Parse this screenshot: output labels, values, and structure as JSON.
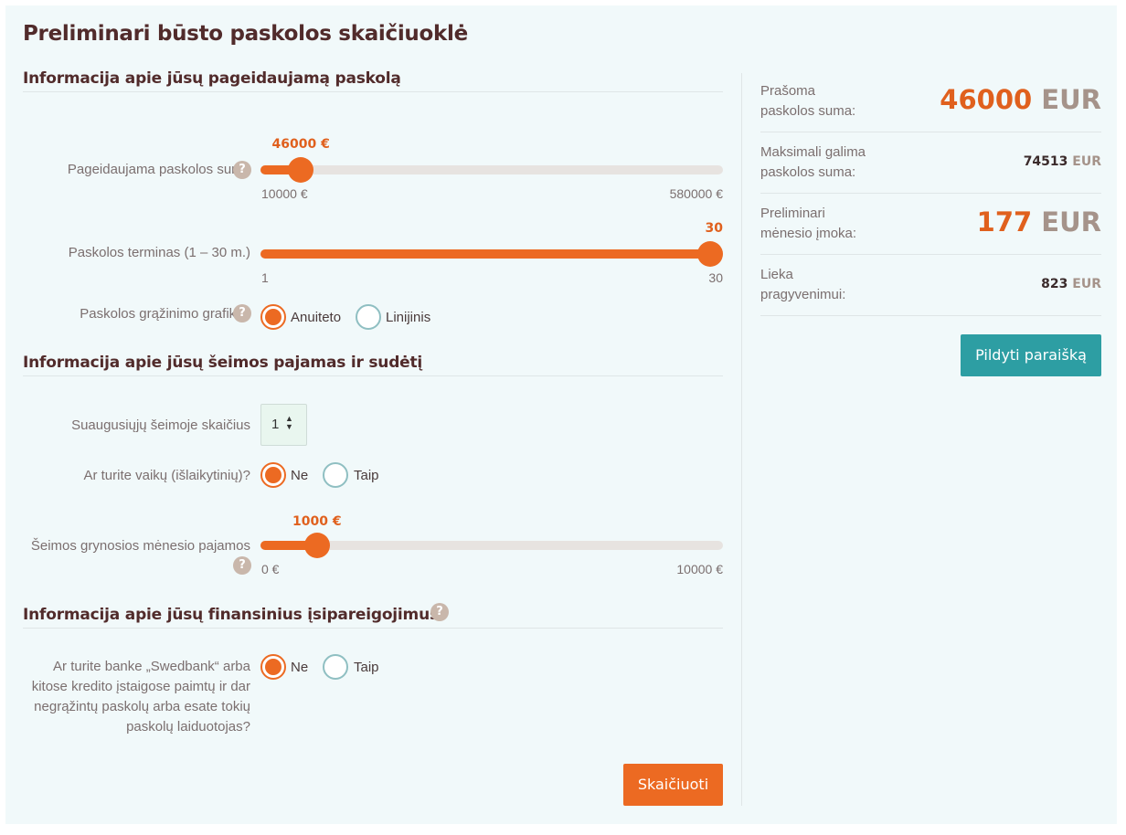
{
  "title": "Preliminari būsto paskolos skaičiuoklė",
  "colors": {
    "accent": "#ec6a22",
    "teal": "#2d9ea3",
    "heading": "#512b2b"
  },
  "section_loan": {
    "heading": "Informacija apie jūsų pageidaujamą paskolą",
    "amount": {
      "label": "Pageidaujama paskolos suma",
      "value_text": "46000 €",
      "min": "10000 €",
      "max": "580000 €",
      "fraction": 0.0632
    },
    "term": {
      "label": "Paskolos terminas (1 – 30 m.)",
      "value_text": "30",
      "min": "1",
      "max": "30",
      "fraction": 1.0
    },
    "schedule": {
      "label": "Paskolos grąžinimo grafikas",
      "options": [
        "Anuiteto",
        "Linijinis"
      ],
      "selected": "Anuiteto"
    }
  },
  "section_family": {
    "heading": "Informacija apie jūsų šeimos pajamas ir sudėtį",
    "adults": {
      "label": "Suaugusiųjų šeimoje skaičius",
      "value": "1"
    },
    "children": {
      "label": "Ar turite vaikų (išlaikytinių)?",
      "options": [
        "Ne",
        "Taip"
      ],
      "selected": "Ne"
    },
    "income": {
      "label": "Šeimos grynosios mėnesio pajamos",
      "value_text": "1000 €",
      "min": "0 €",
      "max": "10000 €",
      "fraction": 0.1
    }
  },
  "section_obligations": {
    "heading": "Informacija apie jūsų finansinius įsipareigojimus",
    "question": {
      "label_lines": [
        "Ar turite banke „Swedbank“ arba",
        "kitose kredito įstaigose paimtų ir dar",
        "negrąžintų paskolų arba esate tokių",
        "paskolų laiduotojas?"
      ],
      "options": [
        "Ne",
        "Taip"
      ],
      "selected": "Ne"
    }
  },
  "calculate_button": "Skaičiuoti",
  "summary": [
    {
      "label_lines": [
        "Prašoma",
        "paskolos suma:"
      ],
      "value": "46000",
      "unit": "EUR",
      "big": true
    },
    {
      "label_lines": [
        "Maksimali galima",
        "paskolos suma:"
      ],
      "value": "74513",
      "unit": "EUR",
      "big": false
    },
    {
      "label_lines": [
        "Preliminari",
        "mėnesio įmoka:"
      ],
      "value": "177",
      "unit": "EUR",
      "big": true
    },
    {
      "label_lines": [
        "Lieka",
        "pragyvenimui:"
      ],
      "value": "823",
      "unit": "EUR",
      "big": false
    }
  ],
  "apply_button": "Pildyti paraišką",
  "help_glyph": "?"
}
